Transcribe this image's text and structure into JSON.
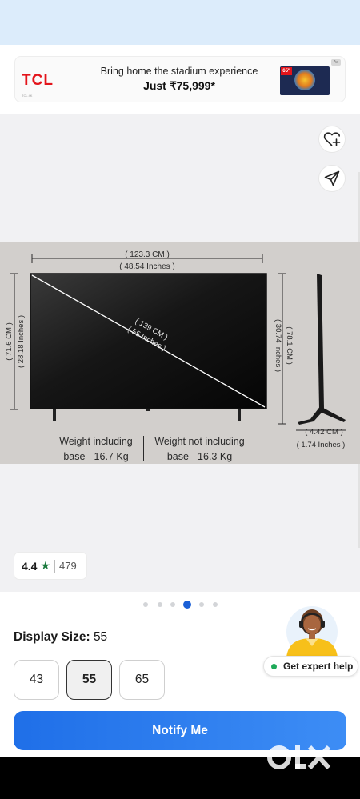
{
  "ad": {
    "brand": "TCL",
    "brand_sub": "TCL 4K",
    "headline": "Bring home the stadium experience",
    "price_line": "Just ₹75,999*",
    "thumb_badge": "65\"",
    "ad_chip": "Ad",
    "brand_color": "#e3141b"
  },
  "gallery": {
    "wishlist_icon": "heart-plus-icon",
    "share_icon": "share-send-icon",
    "dimensions": {
      "width_cm": "( 123.3 CM )",
      "width_in": "( 48.54 Inches )",
      "diag_cm": "( 139 CM )",
      "diag_in": "( 55 Inches )",
      "height_cm": "( 71.6 CM )",
      "height_in": "( 28.18 Inches )",
      "height_base_cm": "( 78.1 CM )",
      "height_base_in": "( 30.74 Inches )",
      "depth_cm": "( 4.42 CM )",
      "depth_in": "( 1.74 Inches )"
    },
    "weight_with_base_1": "Weight including",
    "weight_with_base_2": "base - 16.7 Kg",
    "weight_without_base_1": "Weight not including",
    "weight_without_base_2": "base - 16.3 Kg",
    "page_count": 6,
    "active_page": 4
  },
  "rating": {
    "value": "4.4",
    "star": "★",
    "count": "479",
    "star_color": "#1b7a3d"
  },
  "display_size": {
    "label": "Display Size:",
    "selected": "55",
    "options": [
      "43",
      "55",
      "65"
    ]
  },
  "expert": {
    "label": "Get expert help",
    "status_color": "#1faa59"
  },
  "cta": {
    "label": "Notify Me",
    "color": "#2b7cf0"
  },
  "watermark": {
    "text": "OLX"
  }
}
